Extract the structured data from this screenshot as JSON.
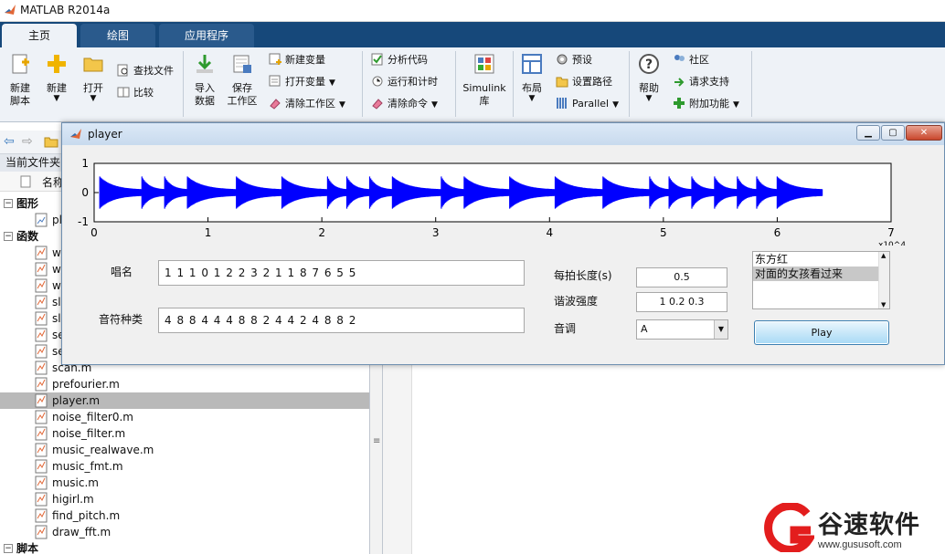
{
  "app": {
    "title": "MATLAB R2014a"
  },
  "ribbon": {
    "tabs": [
      "主页",
      "绘图",
      "应用程序"
    ],
    "buttons": {
      "new_script": "新建\n脚本",
      "new": "新建",
      "open": "打开",
      "find_files": "查找文件",
      "compare": "比较",
      "import_data": "导入\n数据",
      "save_workspace": "保存\n工作区",
      "new_variable": "新建变量",
      "open_variable": "打开变量",
      "clear_workspace": "清除工作区",
      "analyze_code": "分析代码",
      "run_and_time": "运行和计时",
      "clear_commands": "清除命令",
      "simulink": "Simulink\n库",
      "layout": "布局",
      "preferences": "预设",
      "set_path": "设置路径",
      "parallel": "Parallel",
      "help": "帮助",
      "community": "社区",
      "request_support": "请求支持",
      "add_ons": "附加功能"
    }
  },
  "file_browser": {
    "title": "当前文件夹",
    "column": "名称",
    "groups": {
      "figures": "图形",
      "functions": "函数",
      "scripts": "脚本"
    },
    "figure_file": "pl",
    "partial_files": [
      "w",
      "w",
      "w",
      "sl",
      "sl",
      "se",
      "se"
    ],
    "files": [
      "scan.m",
      "prefourier.m",
      "player.m",
      "noise_filter0.m",
      "noise_filter.m",
      "music_realwave.m",
      "music_fmt.m",
      "music.m",
      "higirl.m",
      "find_pitch.m",
      "draw_fft.m"
    ],
    "selected": "player.m"
  },
  "player": {
    "title": "player",
    "labels": {
      "notes": "唱名",
      "note_types": "音符种类",
      "beat_length": "每拍长度(s)",
      "harmonic": "谐波强度",
      "key": "音调"
    },
    "inputs": {
      "notes": "1 1 1 0 1 2 2 3 2 1 1 8 7 6 5 5",
      "note_types": "4 8 8 4 4 4 8 8 2 4 4 2 4 8 8 2",
      "beat_length": "0.5",
      "harmonic": "1 0.2 0.3",
      "key": "A"
    },
    "songs": [
      "东方红",
      "对面的女孩看过来"
    ],
    "selected_song": "对面的女孩看过来",
    "play_button": "Play",
    "axes": {
      "xlim": [
        0,
        7
      ],
      "ylim": [
        -1,
        1
      ],
      "xticks": [
        "0",
        "1",
        "2",
        "3",
        "4",
        "5",
        "6",
        "7"
      ],
      "yticks": [
        "1",
        "0",
        "-1"
      ],
      "exponent": "x10^4",
      "line_color": "#0000ff",
      "note_onsets": [
        0.05,
        0.42,
        0.62,
        0.82,
        1.25,
        1.65,
        2.05,
        2.22,
        2.42,
        2.62,
        3.05,
        3.25,
        3.65,
        4.05,
        4.47,
        4.88,
        5.05,
        5.25,
        5.45,
        5.65,
        5.82,
        6.0
      ],
      "end_time": 6.4
    }
  },
  "watermark": {
    "text": "谷速软件",
    "url": "www.gususoft.com",
    "color": "#e31d1d"
  }
}
